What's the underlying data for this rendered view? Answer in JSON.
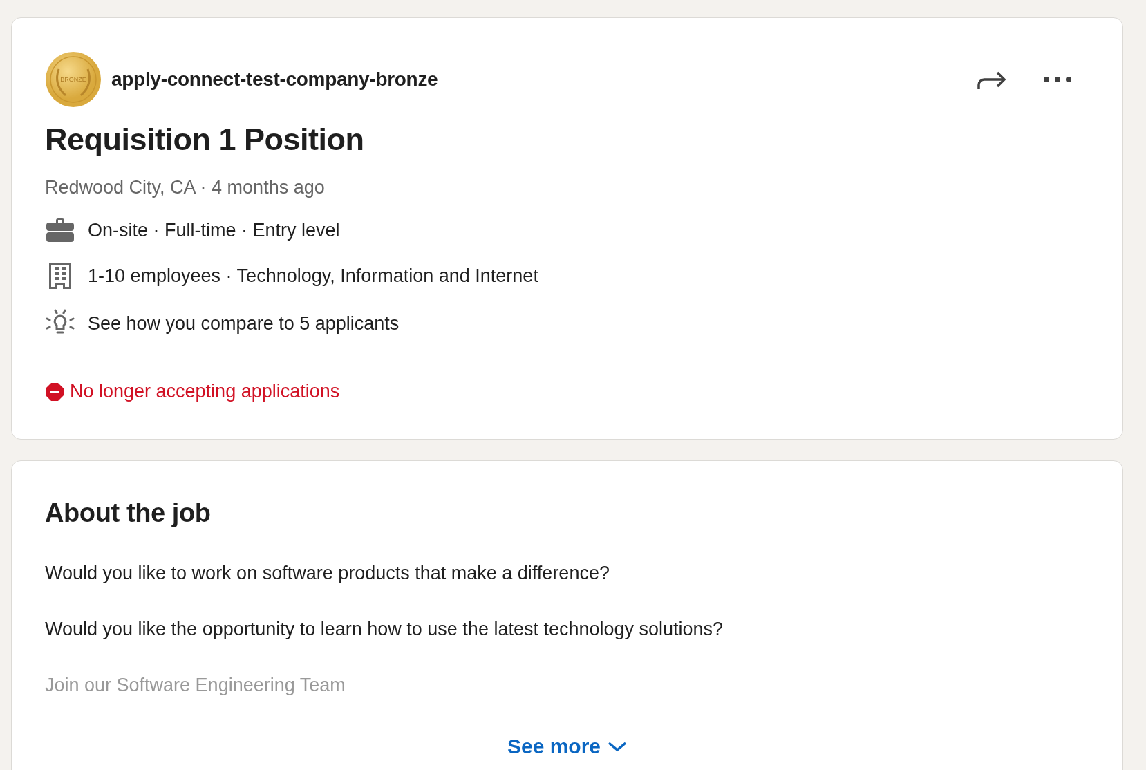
{
  "job_card": {
    "company": "apply-connect-test-company-bronze",
    "logo_text": "BRONZE",
    "title": "Requisition 1 Position",
    "meta": "Redwood City, CA · 4 months ago",
    "insights": [
      {
        "kind": "briefcase",
        "text": "On-site · Full-time · Entry level"
      },
      {
        "kind": "building",
        "text": "1-10 employees · Technology, Information and Internet"
      },
      {
        "kind": "lightbulb",
        "text": "See how you compare to 5 applicants"
      }
    ],
    "status": "No longer accepting applications"
  },
  "about": {
    "heading": "About the job",
    "paragraphs": [
      {
        "kind": "text",
        "text": "Would you like to work on software products that make a difference?"
      },
      {
        "kind": "text",
        "text": "Would you like the opportunity to learn how to use the latest technology solutions?"
      },
      {
        "kind": "faded",
        "text": "Join our Software Engineering Team"
      }
    ],
    "see_more": "See more"
  }
}
